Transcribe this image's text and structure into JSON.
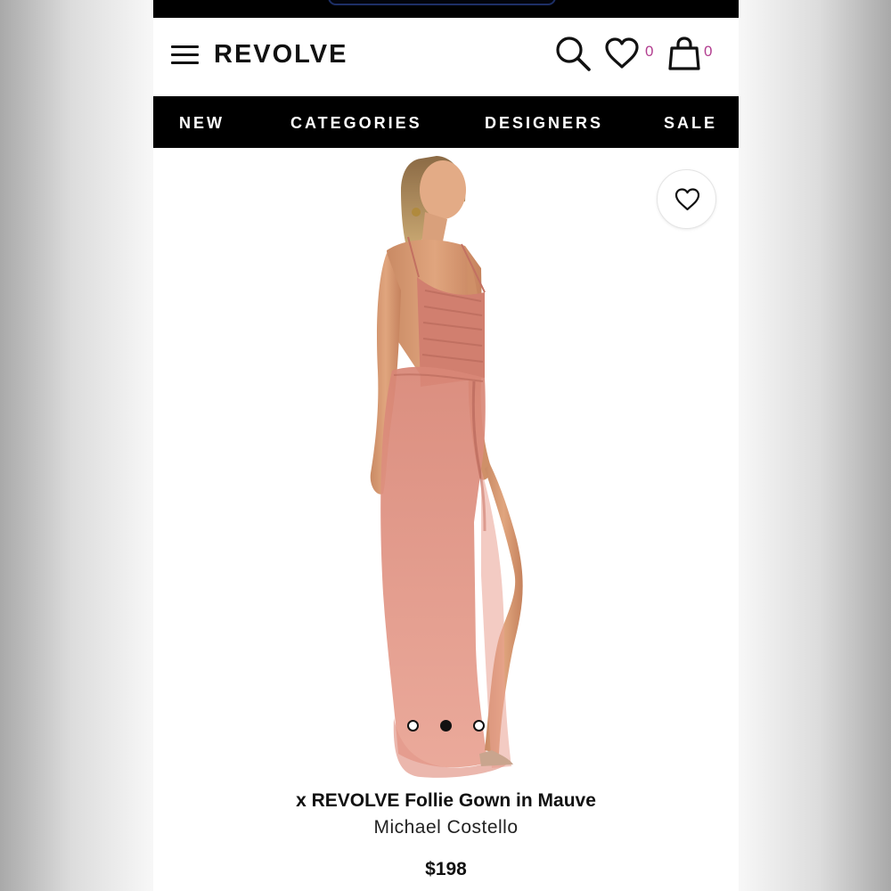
{
  "header": {
    "logo": "REVOLVE",
    "wishlist_count": "0",
    "cart_count": "0"
  },
  "nav": {
    "items": [
      "NEW",
      "CATEGORIES",
      "DESIGNERS",
      "SALE"
    ]
  },
  "product": {
    "title": "x REVOLVE Follie Gown in Mauve",
    "designer": "Michael Costello",
    "price": "$198",
    "image_index": 2,
    "image_count": 3
  },
  "colors": {
    "accent_count": "#b23d8f",
    "nav_background": "#000000",
    "dress": "#d7867a"
  },
  "icons": {
    "menu": "hamburger-icon",
    "search": "search-icon",
    "wishlist": "heart-icon",
    "cart": "shopping-bag-icon",
    "favorite": "heart-outline-icon"
  }
}
